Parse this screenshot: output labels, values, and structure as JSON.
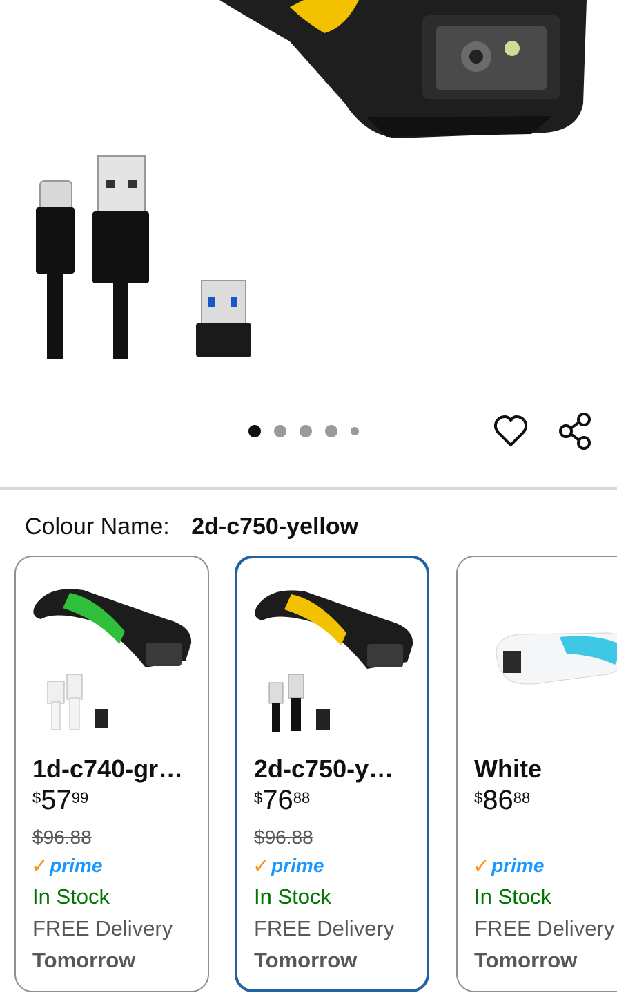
{
  "gallery": {
    "page_count": 5,
    "active_index": 0
  },
  "actions": {
    "wishlist_icon": "heart-icon",
    "share_icon": "share-icon"
  },
  "colour": {
    "label": "Colour Name:",
    "selected": "2d-c750-yellow"
  },
  "variants": [
    {
      "name": "1d-c740-gr…",
      "price_symbol": "$",
      "price_whole": "57",
      "price_fraction": "99",
      "list_price": "$96.88",
      "prime": "prime",
      "stock": "In Stock",
      "delivery": "FREE Delivery",
      "delivery_day": "Tomorrow",
      "accent": "#2fbf3a"
    },
    {
      "name": "2d-c750-y…",
      "price_symbol": "$",
      "price_whole": "76",
      "price_fraction": "88",
      "list_price": "$96.88",
      "prime": "prime",
      "stock": "In Stock",
      "delivery": "FREE Delivery",
      "delivery_day": "Tomorrow",
      "accent": "#f5c518"
    },
    {
      "name": "White",
      "price_symbol": "$",
      "price_whole": "86",
      "price_fraction": "88",
      "list_price": "",
      "prime": "prime",
      "stock": "In Stock",
      "delivery": "FREE Delivery",
      "delivery_day": "Tomorrow",
      "accent": "#3ec8e6"
    }
  ],
  "colors": {
    "selected_border": "#2162a1",
    "in_stock": "#007600",
    "prime_blue": "#1a98ff",
    "prime_check": "#f7941d"
  }
}
